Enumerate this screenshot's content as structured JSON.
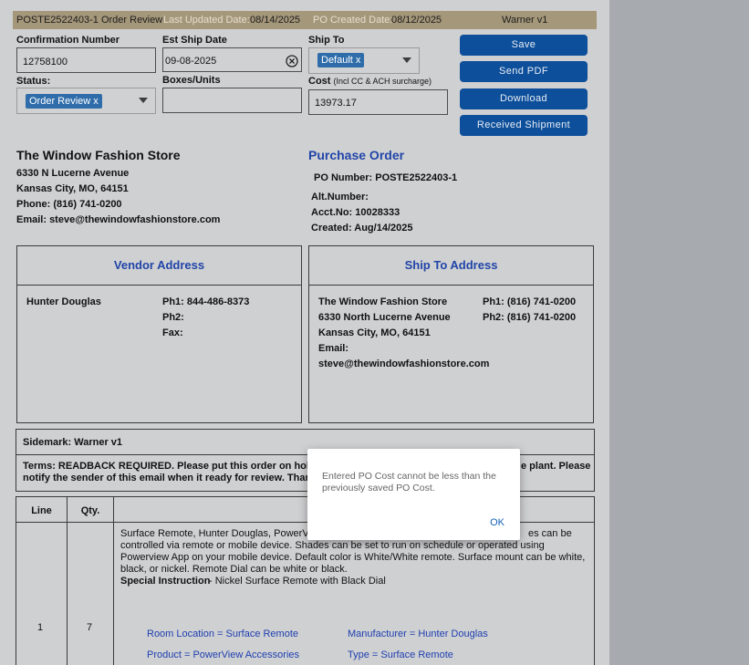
{
  "header": {
    "order_title": "POSTE2522403-1 Order Review",
    "last_updated_label": "Last Updated Date:",
    "last_updated_value": "08/14/2025",
    "po_created_label": "PO Created Date:",
    "po_created_value": "08/12/2025",
    "sidemark": "Warner v1"
  },
  "form": {
    "confirmation_label": "Confirmation Number",
    "confirmation_value": "12758100",
    "est_ship_label": "Est Ship Date",
    "est_ship_value": "09-08-2025",
    "ship_to_label": "Ship To",
    "ship_to_chip": "Default x",
    "status_label": "Status:",
    "status_chip": "Order Review x",
    "boxes_label": "Boxes/Units",
    "boxes_value": "",
    "cost_label": "Cost",
    "cost_note": "(Incl CC & ACH surcharge)",
    "cost_value": "13973.17"
  },
  "buttons": {
    "save": "Save",
    "send_pdf": "Send PDF",
    "download": "Download",
    "received": "Received Shipment"
  },
  "store": {
    "name": "The Window Fashion Store",
    "address1": "6330 N Lucerne Avenue",
    "address2": "Kansas City, MO, 64151",
    "phone": "Phone: (816) 741-0200",
    "email": "Email: steve@thewindowfashionstore.com"
  },
  "purchase_order": {
    "title": "Purchase Order",
    "po_number": "PO Number: POSTE2522403-1",
    "alt_number": "Alt.Number:",
    "acct_no": "Acct.No: 10028333",
    "created": "Created: Aug/14/2025"
  },
  "vendor": {
    "title": "Vendor Address",
    "name": "Hunter Douglas",
    "ph1": "Ph1: 844-486-8373",
    "ph2": "Ph2:",
    "fax": "Fax:"
  },
  "ship_to": {
    "title": "Ship To Address",
    "line1": "The Window Fashion Store",
    "line2": "6330 North Lucerne Avenue",
    "line3": "Kansas City, MO, 64151",
    "email_label": "Email:",
    "email": "steve@thewindowfashionstore.com",
    "ph1": "Ph1: (816) 741-0200",
    "ph2": "Ph2: (816) 741-0200"
  },
  "sidemark_row": "Sidemark: Warner v1",
  "terms": {
    "line1_start": "Terms: READBACK REQUIRED. Please put this order on hold and",
    "line1_end": "e plant. Please",
    "line2": "notify the sender of this email when it ready for review. Thank y"
  },
  "table": {
    "col_line": "Line",
    "col_qty": "Qty.",
    "row": {
      "line": "1",
      "qty": "7",
      "desc1_start": "Surface Remote, Hunter Douglas, PowerVi",
      "desc1_end": "es can be",
      "desc2": "controlled via remote or mobile device. Shades can be set to run on schedule or operated using",
      "desc3": "Powerview App on your mobile device. Default color is White/White remote. Surface mount can be white,",
      "desc4": "black, or nickel. Remote Dial can be white or black.",
      "special_label": "Special Instruction",
      "special_text": " - Nickel Surface Remote with Black Dial",
      "room_location": "Room Location = Surface Remote",
      "manufacturer": "Manufacturer = Hunter Douglas",
      "product": "Product = PowerView Accessories",
      "type": "Type = Surface Remote"
    }
  },
  "modal": {
    "message": "Entered PO Cost cannot be less than the previously saved PO Cost.",
    "ok": "OK"
  },
  "colors": {
    "button_blue": "#0d4f9a",
    "chip_blue": "#2f6daa",
    "header_tan": "#a5977a",
    "heading_blue": "#2145a8"
  }
}
